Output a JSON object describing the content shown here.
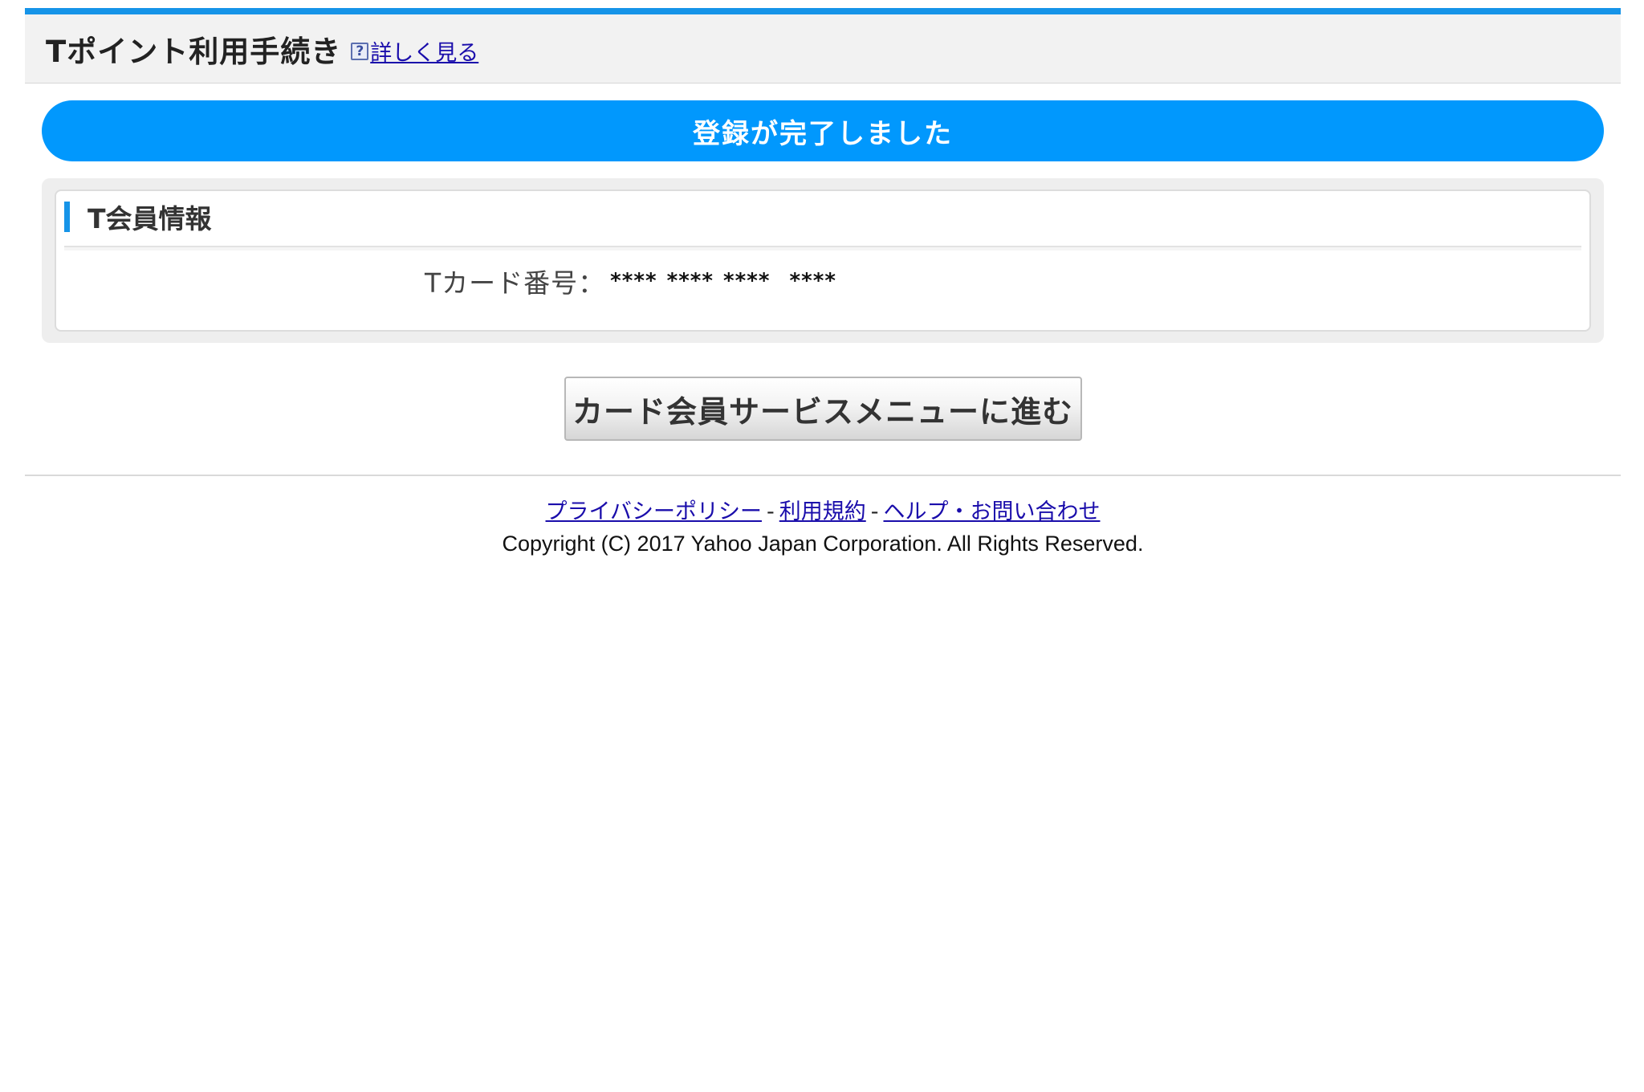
{
  "header": {
    "title": "Tポイント利用手続き",
    "help_icon": "question-mark-icon",
    "help_link": "詳しく見る"
  },
  "banner": {
    "message": "登録が完了しました"
  },
  "member_info": {
    "heading": "T会員情報",
    "card_label": "Tカード番号：",
    "card_value": "**** **** ****  ****"
  },
  "actions": {
    "menu_button": "カード会員サービスメニューに進む"
  },
  "footer": {
    "links": [
      {
        "label": "プライバシーポリシー"
      },
      {
        "label": "利用規約"
      },
      {
        "label": "ヘルプ・お問い合わせ"
      }
    ],
    "separator": "-",
    "copyright": "Copyright (C) 2017 Yahoo Japan Corporation. All Rights Reserved."
  },
  "colors": {
    "accent": "#1694e8",
    "banner": "#0198fd",
    "link": "#1a0dab"
  }
}
